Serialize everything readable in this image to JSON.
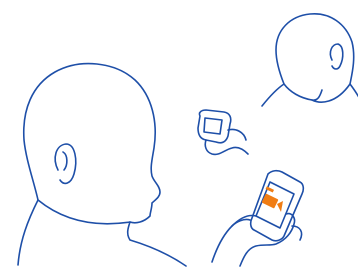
{
  "illustration": {
    "colors": {
      "line": "#1e4fa8",
      "screen_accent": "#f07d14",
      "background": "#ffffff"
    },
    "icons": {
      "video_call": "video-camera-icon"
    }
  }
}
